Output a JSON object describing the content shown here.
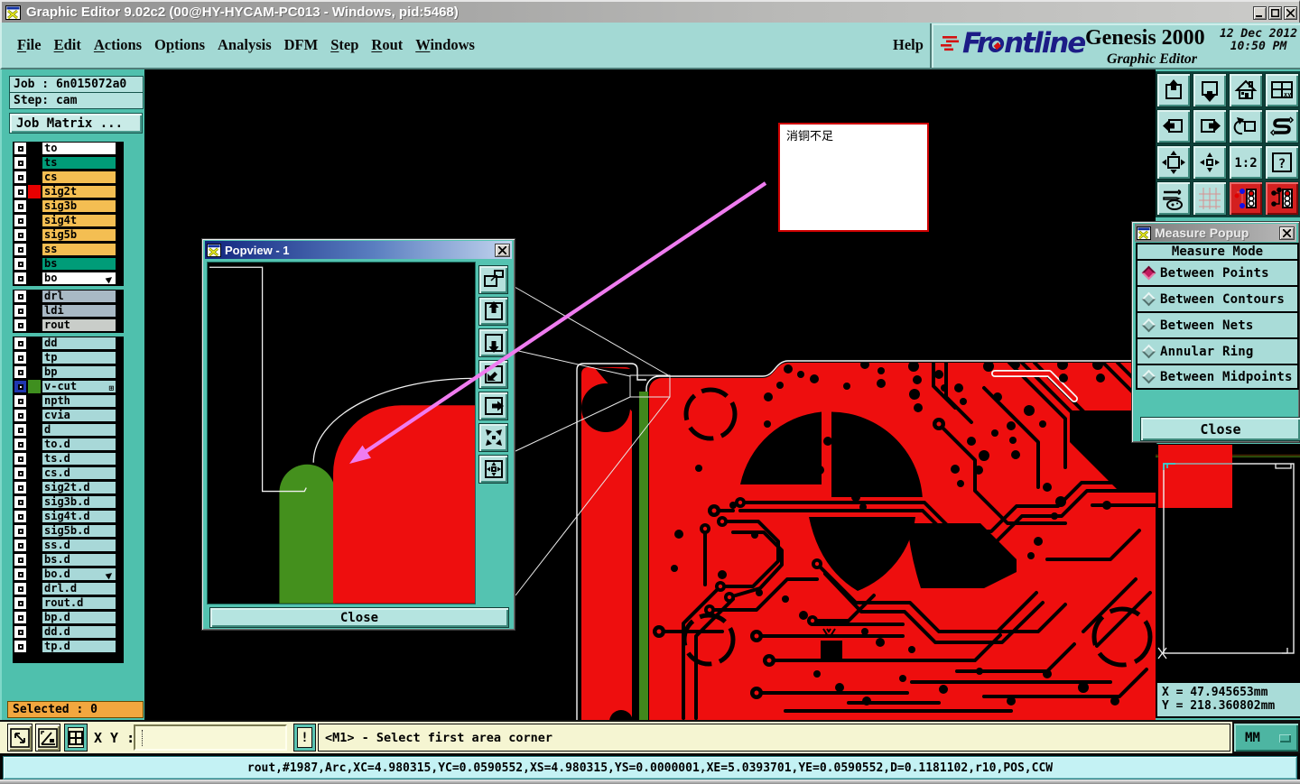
{
  "window": {
    "title": "Graphic Editor 9.02c2 (00@HY-HYCAM-PC013 - Windows, pid:5468)",
    "icon": "app-icon",
    "controls": [
      "minimize",
      "maximize",
      "close"
    ]
  },
  "menubar": {
    "items": [
      {
        "label": "File",
        "underline": 0
      },
      {
        "label": "Edit",
        "underline": 0
      },
      {
        "label": "Actions",
        "underline": 0
      },
      {
        "label": "Options",
        "underline": 1
      },
      {
        "label": "Analysis",
        "underline": -1
      },
      {
        "label": "DFM",
        "underline": -1
      },
      {
        "label": "Step",
        "underline": 0
      },
      {
        "label": "Rout",
        "underline": 0
      },
      {
        "label": "Windows",
        "underline": 0
      }
    ],
    "help_label": "Help"
  },
  "logo": {
    "brand": "Frontline",
    "brand_color": "#1c1c86",
    "product": "Genesis 2000",
    "subtitle": "Graphic Editor",
    "date": "12 Dec 2012",
    "time": "10:50 PM"
  },
  "sidebar": {
    "job_label": "Job : ",
    "job_value": "6n015072a0",
    "step_label": "Step: ",
    "step_value": "cam",
    "matrix_button": "Job Matrix ...",
    "selected_label": "Selected : 0",
    "layers": [
      {
        "name": "to",
        "bg": "#ffffff"
      },
      {
        "name": "ts",
        "bg": "#009c78"
      },
      {
        "name": "cs",
        "bg": "#f4be52"
      },
      {
        "name": "sig2t",
        "bg": "#f4be52",
        "swatch": "#e80000"
      },
      {
        "name": "sig3b",
        "bg": "#f4be52"
      },
      {
        "name": "sig4t",
        "bg": "#f4be52"
      },
      {
        "name": "sig5b",
        "bg": "#f4be52"
      },
      {
        "name": "ss",
        "bg": "#f4be52"
      },
      {
        "name": "bs",
        "bg": "#009c78"
      },
      {
        "name": "bo",
        "bg": "#ffffff",
        "cursor": true
      },
      {
        "sep": true
      },
      {
        "name": "drl",
        "bg": "#a9b9c5"
      },
      {
        "name": "ldi",
        "bg": "#a9b9c5"
      },
      {
        "name": "rout",
        "bg": "#c9cdc9"
      },
      {
        "sep": true
      },
      {
        "name": "dd",
        "bg": "#a8d8d8"
      },
      {
        "name": "tp",
        "bg": "#a8d8d8"
      },
      {
        "name": "bp",
        "bg": "#a8d8d8"
      },
      {
        "name": "v-cut",
        "bg": "#a8d8d8",
        "swatch": "#3f8f1f",
        "check": "blue",
        "grid": true
      },
      {
        "name": "npth",
        "bg": "#a8d8d8"
      },
      {
        "name": "cvia",
        "bg": "#a8d8d8"
      },
      {
        "name": "d",
        "bg": "#a8d8d8"
      },
      {
        "name": "to.d",
        "bg": "#a8d8d8"
      },
      {
        "name": "ts.d",
        "bg": "#a8d8d8"
      },
      {
        "name": "cs.d",
        "bg": "#a8d8d8"
      },
      {
        "name": "sig2t.d",
        "bg": "#a8d8d8"
      },
      {
        "name": "sig3b.d",
        "bg": "#a8d8d8"
      },
      {
        "name": "sig4t.d",
        "bg": "#a8d8d8"
      },
      {
        "name": "sig5b.d",
        "bg": "#a8d8d8"
      },
      {
        "name": "ss.d",
        "bg": "#a8d8d8"
      },
      {
        "name": "bs.d",
        "bg": "#a8d8d8"
      },
      {
        "name": "bo.d",
        "bg": "#a8d8d8",
        "cursor": true
      },
      {
        "name": "drl.d",
        "bg": "#a8d8d8"
      },
      {
        "name": "rout.d",
        "bg": "#a8d8d8"
      },
      {
        "name": "bp.d",
        "bg": "#a8d8d8"
      },
      {
        "name": "dd.d",
        "bg": "#a8d8d8"
      },
      {
        "name": "tp.d",
        "bg": "#a8d8d8"
      }
    ]
  },
  "annotation": {
    "text": "消铜不足",
    "border_color": "#cf0000"
  },
  "popview": {
    "title": "Popview - 1",
    "close_label": "Close",
    "tools": [
      {
        "icon": "zoom-window-icon"
      },
      {
        "icon": "pan-up-icon"
      },
      {
        "icon": "pan-down-icon"
      },
      {
        "icon": "pan-corner-icon"
      },
      {
        "icon": "pan-right-icon"
      },
      {
        "icon": "zoom-in-arrows-icon"
      },
      {
        "icon": "pan-all-icon"
      }
    ]
  },
  "measure_popup": {
    "title": "Measure Popup",
    "header": "Measure Mode",
    "options": [
      {
        "label": "Between Points",
        "selected": true
      },
      {
        "label": "Between Contours",
        "selected": false
      },
      {
        "label": "Between Nets",
        "selected": false
      },
      {
        "label": "Annular Ring",
        "selected": false
      },
      {
        "label": "Between Midpoints",
        "selected": false
      }
    ],
    "close_label": "Close",
    "selected_color": "#c21a5e"
  },
  "right_toolbar": {
    "buttons": [
      {
        "icon": "clipboard-up-icon"
      },
      {
        "icon": "window-down-icon"
      },
      {
        "icon": "home-icon"
      },
      {
        "icon": "panes-xy-icon"
      },
      {
        "icon": "window-left-icon"
      },
      {
        "icon": "window-right-icon"
      },
      {
        "icon": "prev-view-icon"
      },
      {
        "icon": "s-step-icon"
      },
      {
        "icon": "zoom-extents-icon"
      },
      {
        "icon": "zoom-center-icon"
      },
      {
        "icon": "ratio-1-2-icon"
      },
      {
        "icon": "query-icon"
      },
      {
        "icon": "tools-icon"
      },
      {
        "icon": "grid-icon"
      },
      {
        "icon": "net-vias-blue-icon",
        "active": true
      },
      {
        "icon": "net-vias-black-icon",
        "active": true
      }
    ]
  },
  "overview": {
    "x_readout": "X = 47.945653mm",
    "y_readout": "Y = 218.360802mm"
  },
  "statusbar": {
    "buttons": [
      {
        "icon": "resize-diag-icon"
      },
      {
        "icon": "angle-measure-icon"
      },
      {
        "icon": "grid-window-icon",
        "active": true
      }
    ],
    "xy_label": "X Y :",
    "input_value": "",
    "alert_label": "!",
    "message": "<M1> - Select first area corner",
    "units": "MM"
  },
  "infobar": {
    "text": "rout,#1987,Arc,XC=4.980315,YC=0.0590552,XS=4.980315,YS=0.0000001,XE=5.0393701,YE=0.0590552,D=0.1181102,r10,POS,CCW"
  },
  "colors": {
    "copper_red": "#ee0e0e",
    "vcut_green": "#41881c",
    "panel_teal": "#4fc0ad",
    "menu_teal": "#a3d9d4",
    "highlight_magenta": "#ef7cf0",
    "status_yellow": "#f5f5d2",
    "info_cyan": "#c4f2f4",
    "selected_orange": "#f2a73f"
  }
}
